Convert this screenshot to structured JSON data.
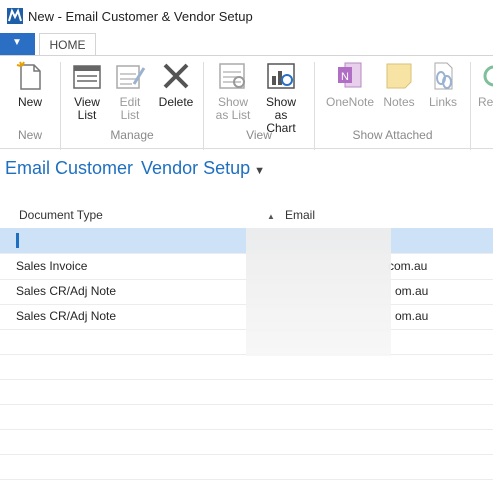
{
  "window": {
    "title": "New - Email Customer & Vendor Setup"
  },
  "tabs": {
    "home": "HOME"
  },
  "ribbon": {
    "new": {
      "label1": "New",
      "label2": ""
    },
    "view_list": {
      "label1": "View",
      "label2": "List"
    },
    "edit_list": {
      "label1": "Edit",
      "label2": "List"
    },
    "delete": {
      "label1": "Delete",
      "label2": ""
    },
    "show_as_list": {
      "label1": "Show",
      "label2": "as List"
    },
    "show_as_chart": {
      "label1": "Show as",
      "label2": "Chart"
    },
    "onenote": {
      "label1": "OneNote",
      "label2": ""
    },
    "notes": {
      "label1": "Notes",
      "label2": ""
    },
    "links": {
      "label1": "Links",
      "label2": ""
    },
    "refresh": {
      "label1": "Re"
    },
    "groups": {
      "new": "New",
      "manage": "Manage",
      "view": "View",
      "show_attached": "Show Attached"
    }
  },
  "page": {
    "title_part1": "Email Customer",
    "title_part2": "Vendor Setup"
  },
  "grid": {
    "columns": [
      "Document Type",
      "Email"
    ],
    "rows": [
      {
        "document_type": "",
        "email": ""
      },
      {
        "document_type": "Sales Invoice",
        "email": "com.au"
      },
      {
        "document_type": "Sales CR/Adj Note",
        "email": "om.au"
      },
      {
        "document_type": "Sales CR/Adj Note",
        "email": "om.au"
      }
    ]
  }
}
